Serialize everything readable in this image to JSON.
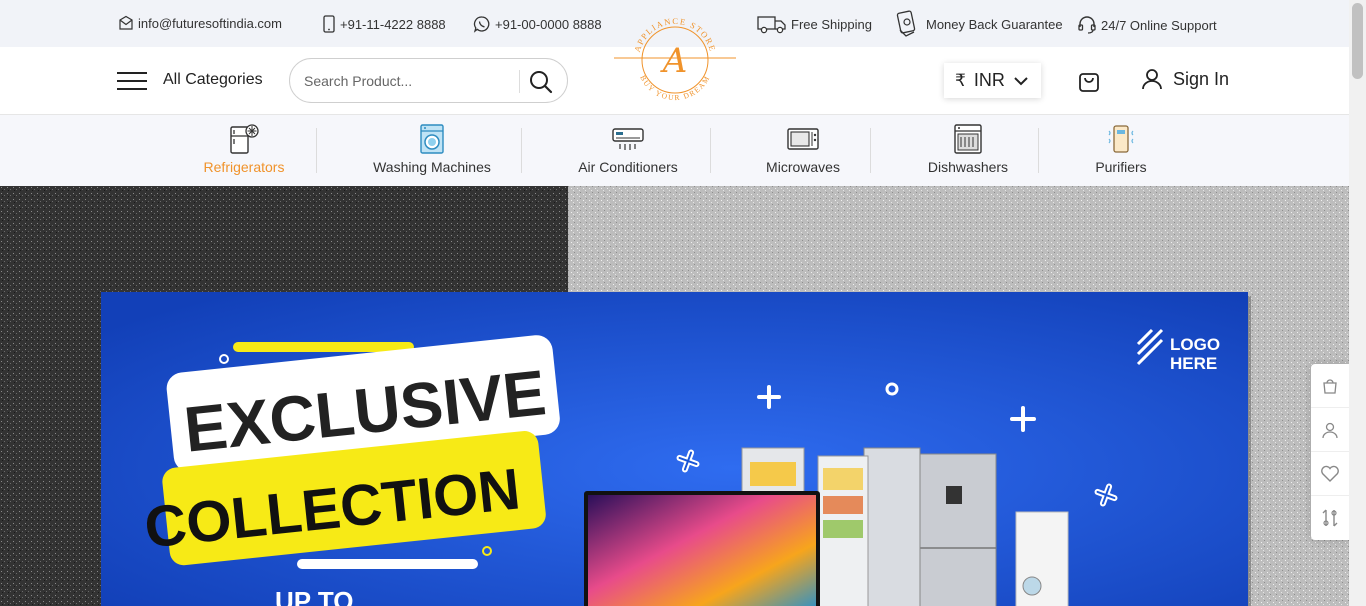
{
  "topbar": {
    "email": "info@futuresoftindia.com",
    "phone": "+91-11-4222 8888",
    "whatsapp": "+91-00-0000 8888",
    "free_shipping": "Free Shipping",
    "money_back": "Money Back Guarantee",
    "support": "24/7 Online Support"
  },
  "header": {
    "all_categories": "All Categories",
    "search_placeholder": "Search Product...",
    "currency_symbol": "₹",
    "currency": "INR",
    "sign_in": "Sign In"
  },
  "logo": {
    "top_text": "APPLIANCE STORE",
    "bottom_text": "BUY YOUR DREAM",
    "letter": "A"
  },
  "categories": [
    {
      "label": "Refrigerators",
      "icon": "refrigerator-icon",
      "active": true
    },
    {
      "label": "Washing Machines",
      "icon": "washing-machine-icon",
      "active": false
    },
    {
      "label": "Air Conditioners",
      "icon": "air-conditioner-icon",
      "active": false
    },
    {
      "label": "Microwaves",
      "icon": "microwave-icon",
      "active": false
    },
    {
      "label": "Dishwashers",
      "icon": "dishwasher-icon",
      "active": false
    },
    {
      "label": "Purifiers",
      "icon": "purifier-icon",
      "active": false
    }
  ],
  "banner": {
    "headline_1": "EXCLUSIVE",
    "headline_2": "COLLECTION",
    "partial_text": "UP TO",
    "logo_line_1": "LOGO",
    "logo_line_2": "HERE"
  },
  "side_actions": [
    "bag-icon",
    "user-icon",
    "heart-icon",
    "compare-icon"
  ],
  "colors": {
    "accent": "#f0932b",
    "banner_blue": "#1a56d6",
    "banner_yellow": "#f7ea16"
  }
}
